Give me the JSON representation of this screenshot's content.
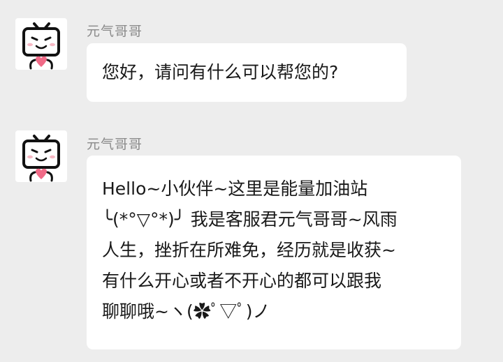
{
  "messages": [
    {
      "sender": "元气哥哥",
      "avatar_icon": "tv-mascot-icon",
      "lines": [
        "您好，请问有什么可以帮您的?"
      ]
    },
    {
      "sender": "元气哥哥",
      "avatar_icon": "tv-mascot-icon",
      "lines": [
        "Hello~小伙伴~这里是能量加油站",
        "╰(*°▽°*)╯ 我是客服君元气哥哥~风雨",
        "人生，挫折在所难免，经历就是收获~",
        "有什么开心或者不开心的都可以跟我",
        "聊聊哦~ヽ(✿ﾟ▽ﾟ)ノ"
      ]
    }
  ],
  "colors": {
    "background": "#ededed",
    "bubble": "#ffffff",
    "sender_name": "#8a8a8a",
    "message_text": "#191919"
  }
}
